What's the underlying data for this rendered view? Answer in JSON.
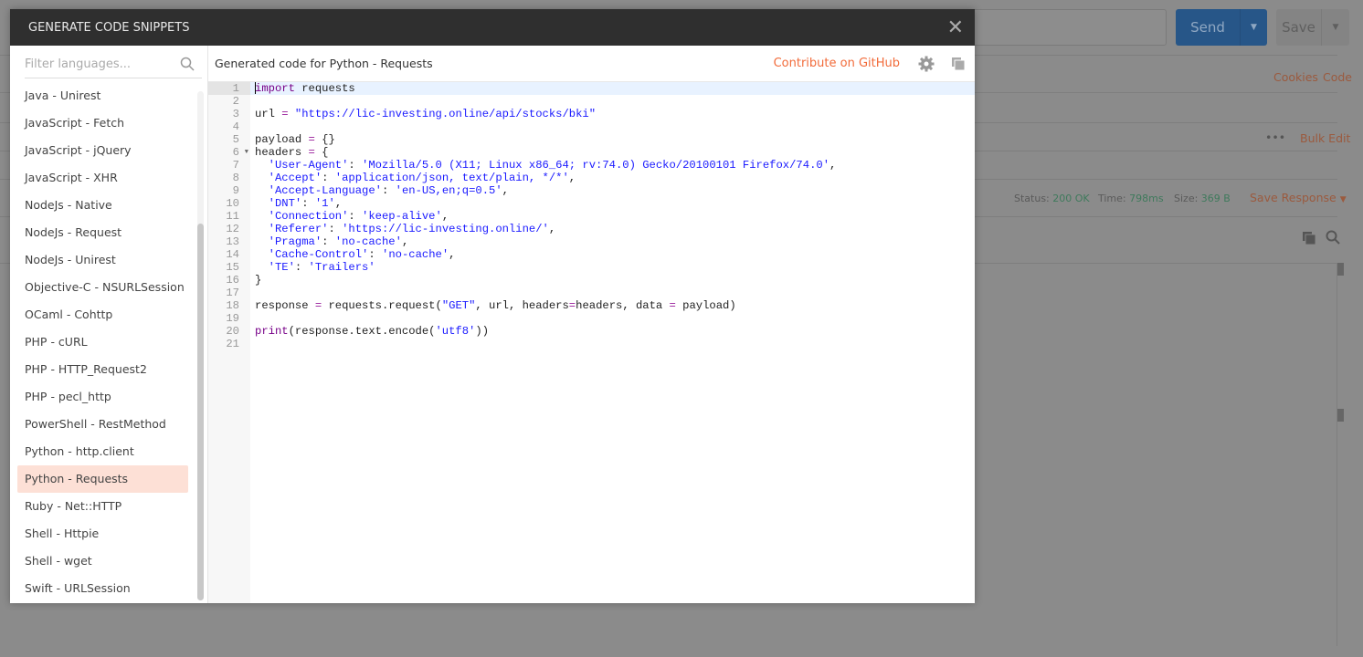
{
  "background": {
    "send_label": "Send",
    "save_label": "Save",
    "links": {
      "cookies": "Cookies",
      "code": "Code",
      "bulk_edit": "Bulk Edit",
      "more": "•••",
      "save_response": "Save Response"
    },
    "status": {
      "status_label": "Status:",
      "status_value": "200 OK",
      "time_label": "Time:",
      "time_value": "798ms",
      "size_label": "Size:",
      "size_value": "369 B"
    }
  },
  "modal": {
    "title": "GENERATE CODE SNIPPETS",
    "filter_placeholder": "Filter languages...",
    "languages": [
      "Java - Unirest",
      "JavaScript - Fetch",
      "JavaScript - jQuery",
      "JavaScript - XHR",
      "NodeJs - Native",
      "NodeJs - Request",
      "NodeJs - Unirest",
      "Objective-C - NSURLSession",
      "OCaml - Cohttp",
      "PHP - cURL",
      "PHP - HTTP_Request2",
      "PHP - pecl_http",
      "PowerShell - RestMethod",
      "Python - http.client",
      "Python - Requests",
      "Ruby - Net::HTTP",
      "Shell - Httpie",
      "Shell - wget",
      "Swift - URLSession"
    ],
    "selected_language": "Python - Requests",
    "code_title": "Generated code for Python - Requests",
    "github_link": "Contribute on GitHub",
    "code_lines": [
      [
        [
          "kw",
          "import"
        ],
        [
          "t",
          " requests"
        ]
      ],
      [],
      [
        [
          "t",
          "url "
        ],
        [
          "op",
          "="
        ],
        [
          "t",
          " "
        ],
        [
          "str",
          "\"https://lic-investing.online/api/stocks/bki\""
        ]
      ],
      [],
      [
        [
          "t",
          "payload "
        ],
        [
          "op",
          "="
        ],
        [
          "t",
          " {}"
        ]
      ],
      [
        [
          "t",
          "headers "
        ],
        [
          "op",
          "="
        ],
        [
          "t",
          " {"
        ]
      ],
      [
        [
          "t",
          "  "
        ],
        [
          "str",
          "'User-Agent'"
        ],
        [
          "t",
          ": "
        ],
        [
          "str",
          "'Mozilla/5.0 (X11; Linux x86_64; rv:74.0) Gecko/20100101 Firefox/74.0'"
        ],
        [
          "t",
          ","
        ]
      ],
      [
        [
          "t",
          "  "
        ],
        [
          "str",
          "'Accept'"
        ],
        [
          "t",
          ": "
        ],
        [
          "str",
          "'application/json, text/plain, */*'"
        ],
        [
          "t",
          ","
        ]
      ],
      [
        [
          "t",
          "  "
        ],
        [
          "str",
          "'Accept-Language'"
        ],
        [
          "t",
          ": "
        ],
        [
          "str",
          "'en-US,en;q=0.5'"
        ],
        [
          "t",
          ","
        ]
      ],
      [
        [
          "t",
          "  "
        ],
        [
          "str",
          "'DNT'"
        ],
        [
          "t",
          ": "
        ],
        [
          "str",
          "'1'"
        ],
        [
          "t",
          ","
        ]
      ],
      [
        [
          "t",
          "  "
        ],
        [
          "str",
          "'Connection'"
        ],
        [
          "t",
          ": "
        ],
        [
          "str",
          "'keep-alive'"
        ],
        [
          "t",
          ","
        ]
      ],
      [
        [
          "t",
          "  "
        ],
        [
          "str",
          "'Referer'"
        ],
        [
          "t",
          ": "
        ],
        [
          "str",
          "'https://lic-investing.online/'"
        ],
        [
          "t",
          ","
        ]
      ],
      [
        [
          "t",
          "  "
        ],
        [
          "str",
          "'Pragma'"
        ],
        [
          "t",
          ": "
        ],
        [
          "str",
          "'no-cache'"
        ],
        [
          "t",
          ","
        ]
      ],
      [
        [
          "t",
          "  "
        ],
        [
          "str",
          "'Cache-Control'"
        ],
        [
          "t",
          ": "
        ],
        [
          "str",
          "'no-cache'"
        ],
        [
          "t",
          ","
        ]
      ],
      [
        [
          "t",
          "  "
        ],
        [
          "str",
          "'TE'"
        ],
        [
          "t",
          ": "
        ],
        [
          "str",
          "'Trailers'"
        ]
      ],
      [
        [
          "t",
          "}"
        ]
      ],
      [],
      [
        [
          "t",
          "response "
        ],
        [
          "op",
          "="
        ],
        [
          "t",
          " requests.request("
        ],
        [
          "str",
          "\"GET\""
        ],
        [
          "t",
          ", url, headers"
        ],
        [
          "op",
          "="
        ],
        [
          "t",
          "headers, data "
        ],
        [
          "op",
          "="
        ],
        [
          "t",
          " payload)"
        ]
      ],
      [],
      [
        [
          "kw",
          "print"
        ],
        [
          "t",
          "(response.text.encode("
        ],
        [
          "str",
          "'utf8'"
        ],
        [
          "t",
          "))"
        ]
      ],
      []
    ],
    "fold_line": 6
  }
}
